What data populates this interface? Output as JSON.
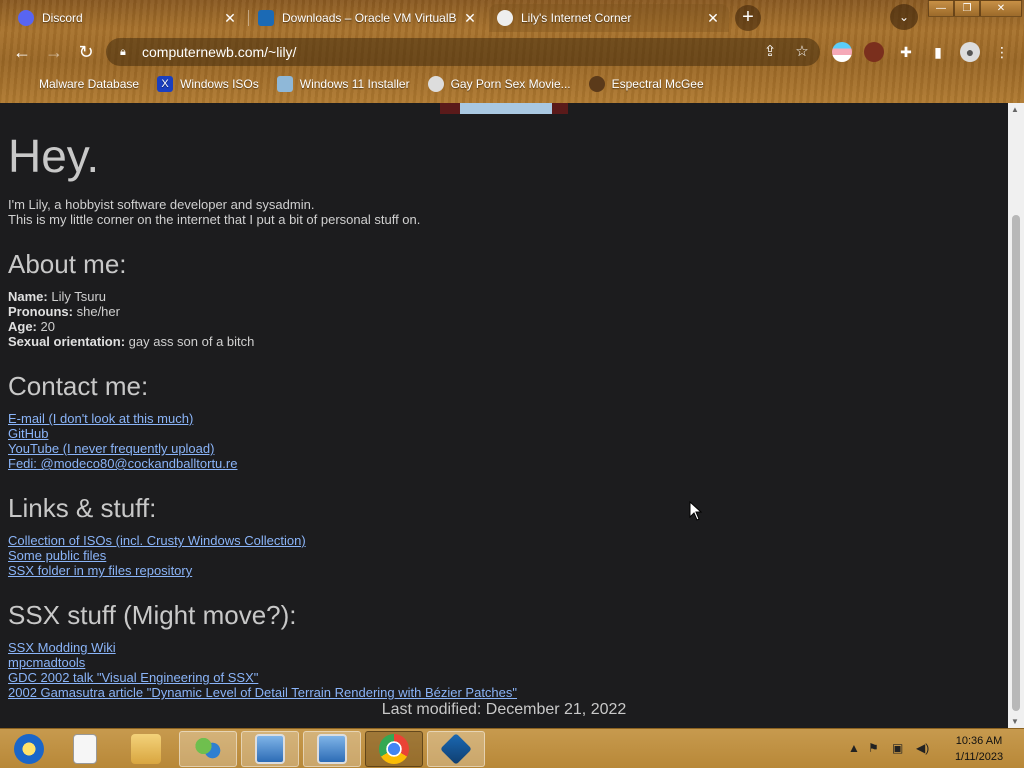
{
  "browser": {
    "tabs": [
      {
        "title": "Discord",
        "icon": "discord-icon"
      },
      {
        "title": "Downloads – Oracle VM VirtualBox",
        "icon": "virtualbox-icon"
      },
      {
        "title": "Lily's Internet Corner",
        "icon": "lily-site-icon"
      }
    ],
    "url": "computernewb.com/~lily/",
    "bookmarks": [
      {
        "label": "Malware Database",
        "icon": "malware-db-icon"
      },
      {
        "label": "Windows ISOs",
        "icon": "windows-isos-icon"
      },
      {
        "label": "Windows 11 Installer",
        "icon": "installer-icon"
      },
      {
        "label": "Gay Porn Sex Movie...",
        "icon": "movie-site-icon"
      },
      {
        "label": "Espectral McGee",
        "icon": "espectral-icon"
      }
    ]
  },
  "page": {
    "heading": "Hey.",
    "intro_line1": "I'm Lily, a hobbyist software developer and sysadmin.",
    "intro_line2": "This is my little corner on the internet that I put a bit of personal stuff on.",
    "about": {
      "heading": "About me:",
      "name_label": "Name:",
      "name_value": " Lily Tsuru",
      "pronouns_label": "Pronouns:",
      "pronouns_value": " she/her",
      "age_label": "Age:",
      "age_value": " 20",
      "orientation_label": "Sexual orientation:",
      "orientation_value": " gay ass son of a bitch"
    },
    "contact": {
      "heading": "Contact me:",
      "links": [
        "E-mail (I don't look at this much)",
        "GitHub",
        "YouTube (I never frequently upload)",
        "Fedi: @modeco80@cockandballtortu.re"
      ]
    },
    "links_stuff": {
      "heading": "Links & stuff:",
      "links": [
        "Collection of ISOs (incl. Crusty Windows Collection)",
        "Some public files",
        "SSX folder in my files repository"
      ]
    },
    "ssx": {
      "heading": "SSX stuff (Might move?):",
      "links": [
        "SSX Modding Wiki",
        "mpcmadtools",
        "GDC 2002 talk \"Visual Engineering of SSX\"",
        "2002 Gamasutra article \"Dynamic Level of Detail Terrain Rendering with Bézier Patches\""
      ]
    },
    "footer": "Last modified: December 21, 2022"
  },
  "taskbar": {
    "apps": [
      "ie-icon",
      "notepad-icon",
      "explorer-icon",
      "network-users-icon",
      "remote-desktop-icon",
      "remote-desktop-2-icon",
      "chrome-icon",
      "virtualbox-icon"
    ],
    "time": "10:36 AM",
    "date": "1/11/2023"
  },
  "colors": {
    "link": "#8ab4f8",
    "page_bg": "#1c1c1e",
    "text": "#c8c8c8"
  }
}
